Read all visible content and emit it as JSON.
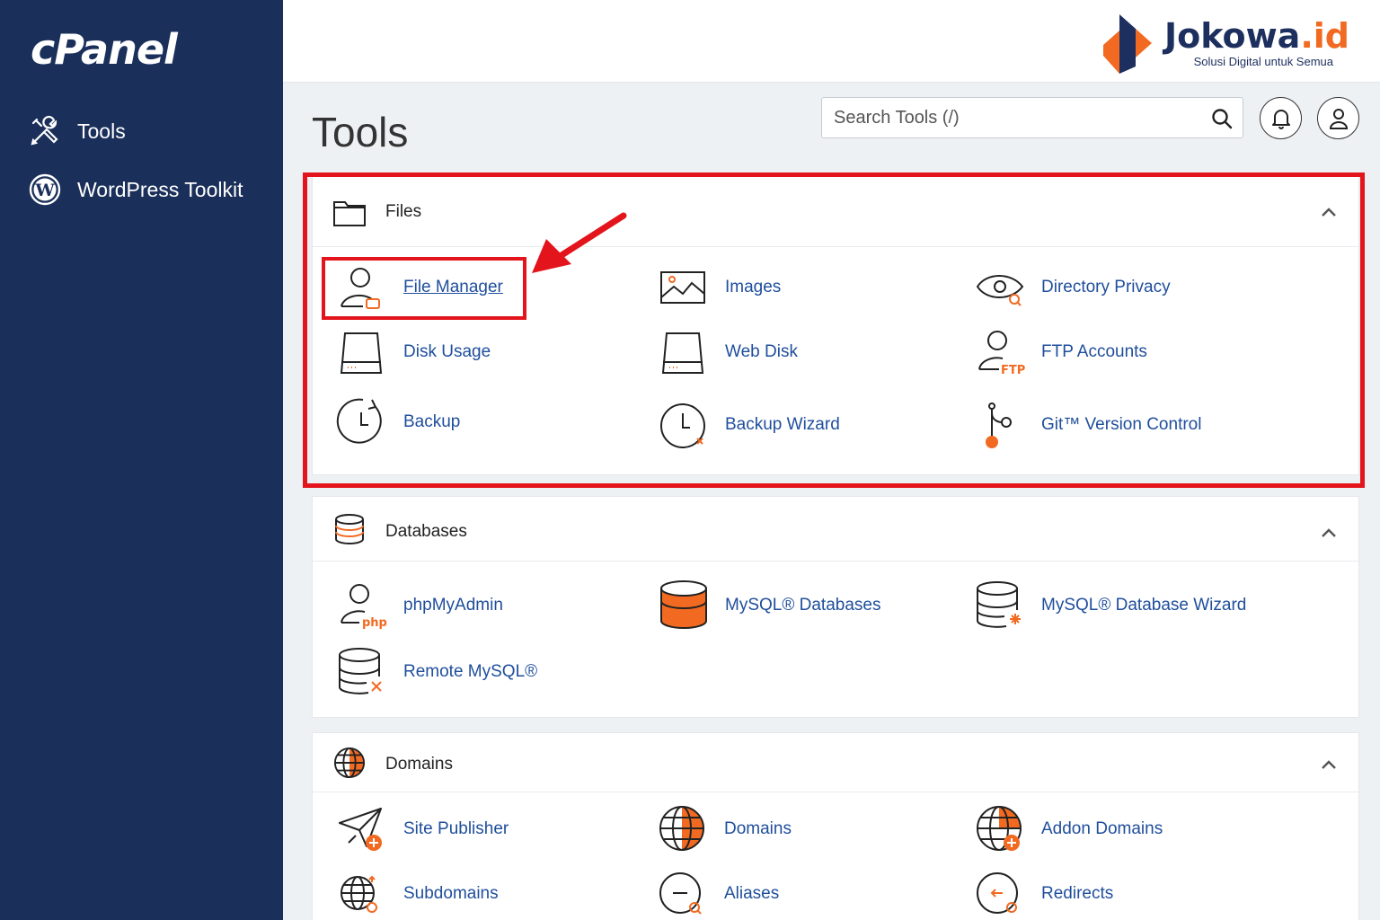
{
  "sidebar": {
    "logo": "cPanel",
    "items": [
      {
        "label": "Tools",
        "icon": "tools-icon"
      },
      {
        "label": "WordPress Toolkit",
        "icon": "wordpress-icon"
      }
    ]
  },
  "brand": {
    "name": "Jokowa",
    "tld": ".id",
    "tagline": "Solusi Digital untuk Semua"
  },
  "header": {
    "title": "Tools",
    "search_placeholder": "Search Tools (/)"
  },
  "sections": {
    "files": {
      "title": "Files",
      "tools": [
        "File Manager",
        "Images",
        "Directory Privacy",
        "Disk Usage",
        "Web Disk",
        "FTP Accounts",
        "Backup",
        "Backup Wizard",
        "Git™ Version Control"
      ]
    },
    "databases": {
      "title": "Databases",
      "tools": [
        "phpMyAdmin",
        "MySQL® Databases",
        "MySQL® Database Wizard",
        "Remote MySQL®"
      ]
    },
    "domains": {
      "title": "Domains",
      "tools": [
        "Site Publisher",
        "Domains",
        "Addon Domains",
        "Subdomains",
        "Aliases",
        "Redirects"
      ]
    }
  },
  "colors": {
    "sidebar": "#1a2f5a",
    "link": "#1f4e9c",
    "accent": "#f26a21",
    "highlight": "#e3141b"
  }
}
